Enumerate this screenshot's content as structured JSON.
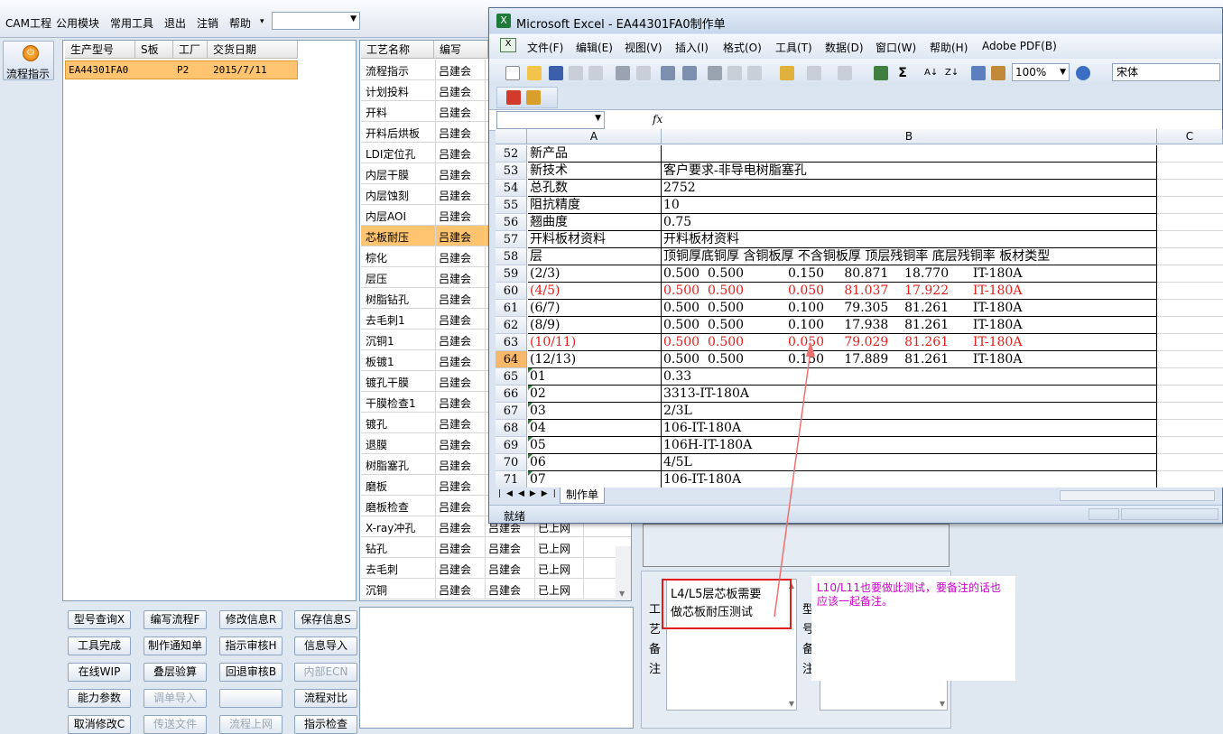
{
  "app": {
    "menu": [
      "CAM工程",
      "公用模块",
      "常用工具",
      "退出",
      "注销",
      "帮助"
    ],
    "help_arrow": "▾",
    "combo_value": ""
  },
  "left_strip": {
    "flow_button": "流程指示"
  },
  "product_grid": {
    "headers": [
      "生产型号",
      "S板",
      "工厂",
      "交货日期"
    ],
    "row": {
      "model": "EA44301FA0",
      "s": "",
      "factory": "P2",
      "date": "2015/7/11"
    }
  },
  "process_list": {
    "headers": [
      "工艺名称",
      "编写"
    ],
    "rows": [
      [
        "流程指示",
        "吕建会",
        "",
        ""
      ],
      [
        "计划投料",
        "吕建会",
        "",
        ""
      ],
      [
        "开料",
        "吕建会",
        "",
        ""
      ],
      [
        "开料后烘板",
        "吕建会",
        "",
        ""
      ],
      [
        "LDI定位孔",
        "吕建会",
        "",
        ""
      ],
      [
        "内层干膜",
        "吕建会",
        "",
        ""
      ],
      [
        "内层蚀刻",
        "吕建会",
        "",
        ""
      ],
      [
        "内层AOI",
        "吕建会",
        "",
        ""
      ],
      [
        "芯板耐压",
        "吕建会",
        "",
        ""
      ],
      [
        "棕化",
        "吕建会",
        "",
        ""
      ],
      [
        "层压",
        "吕建会",
        "",
        ""
      ],
      [
        "树脂钻孔",
        "吕建会",
        "",
        ""
      ],
      [
        "去毛刺1",
        "吕建会",
        "",
        ""
      ],
      [
        "沉铜1",
        "吕建会",
        "",
        ""
      ],
      [
        "板镀1",
        "吕建会",
        "",
        ""
      ],
      [
        "镀孔干膜",
        "吕建会",
        "",
        ""
      ],
      [
        "干膜检查1",
        "吕建会",
        "",
        ""
      ],
      [
        "镀孔",
        "吕建会",
        "",
        ""
      ],
      [
        "退膜",
        "吕建会",
        "",
        ""
      ],
      [
        "树脂塞孔",
        "吕建会",
        "",
        ""
      ],
      [
        "磨板",
        "吕建会",
        "",
        ""
      ],
      [
        "磨板检查",
        "吕建会",
        "",
        ""
      ],
      [
        "X-ray冲孔",
        "吕建会",
        "吕建会",
        "已上网"
      ],
      [
        "钻孔",
        "吕建会",
        "吕建会",
        "已上网"
      ],
      [
        "去毛刺",
        "吕建会",
        "吕建会",
        "已上网"
      ],
      [
        "沉铜",
        "吕建会",
        "吕建会",
        "已上网"
      ]
    ],
    "selected_index": 8
  },
  "buttons": [
    [
      "型号查询X",
      "编写流程F",
      "修改信息R",
      "保存信息S"
    ],
    [
      "工具完成",
      "制作通知单",
      "指示审核H",
      "信息导入"
    ],
    [
      "在线WIP",
      "叠层验算",
      "回退审核B",
      "内部ECN"
    ],
    [
      "能力参数",
      "调单导入",
      "",
      "流程对比"
    ],
    [
      "取消修改C",
      "传送文件",
      "流程上网",
      "指示检查"
    ]
  ],
  "disabled_buttons": [
    "内部ECN",
    "调单导入",
    "传送文件",
    "流程上网"
  ],
  "excel": {
    "title": "Microsoft Excel - EA44301FA0制作单",
    "menu": [
      "文件(F)",
      "编辑(E)",
      "视图(V)",
      "插入(I)",
      "格式(O)",
      "工具(T)",
      "数据(D)",
      "窗口(W)",
      "帮助(H)",
      "Adobe PDF(B)"
    ],
    "zoom": "100%",
    "font": "宋体",
    "fx": "fx",
    "columns": [
      "A",
      "B",
      "C"
    ],
    "rows": [
      {
        "n": "52",
        "a": "新产品",
        "b": ""
      },
      {
        "n": "53",
        "a": "新技术",
        "b": "客户要求-非导电树脂塞孔"
      },
      {
        "n": "54",
        "a": "总孔数",
        "b": "2752"
      },
      {
        "n": "55",
        "a": "阻抗精度",
        "b": "10"
      },
      {
        "n": "56",
        "a": "翘曲度",
        "b": "0.75"
      },
      {
        "n": "57",
        "a": "开料板材资料",
        "b": "开料板材资料"
      },
      {
        "n": "58",
        "a": "层",
        "b": "顶铜厚底铜厚 含铜板厚 不含铜板厚 顶层残铜率 底层残铜率 板材类型"
      },
      {
        "n": "59",
        "a": "(2/3)",
        "b": "0.500  0.500           0.150     80.871    18.770      IT-180A"
      },
      {
        "n": "60",
        "a": "(4/5)",
        "b": "0.500  0.500           0.050     81.037    17.922      IT-180A",
        "red": true
      },
      {
        "n": "61",
        "a": "(6/7)",
        "b": "0.500  0.500           0.100     79.305    81.261      IT-180A"
      },
      {
        "n": "62",
        "a": "(8/9)",
        "b": "0.500  0.500           0.100     17.938    81.261      IT-180A"
      },
      {
        "n": "63",
        "a": "(10/11)",
        "b": "0.500  0.500           0.050     79.029    81.261      IT-180A",
        "red": true
      },
      {
        "n": "64",
        "a": "(12/13)",
        "b": "0.500  0.500           0.150     17.889    81.261      IT-180A",
        "active": true
      },
      {
        "n": "65",
        "a": "01",
        "b": "0.33",
        "tri": true
      },
      {
        "n": "66",
        "a": "02",
        "b": "3313-IT-180A",
        "tri": true
      },
      {
        "n": "67",
        "a": "03",
        "b": "2/3L",
        "tri": true
      },
      {
        "n": "68",
        "a": "04",
        "b": "106-IT-180A",
        "tri": true
      },
      {
        "n": "69",
        "a": "05",
        "b": "106H-IT-180A",
        "tri": true
      },
      {
        "n": "70",
        "a": "06",
        "b": "4/5L",
        "tri": true
      },
      {
        "n": "71",
        "a": "07",
        "b": "106-IT-180A",
        "tri": true
      }
    ],
    "sheet_tab": "制作单",
    "status": "就绪"
  },
  "right_panel": {
    "note_red": "L4/L5层芯板需要",
    "note_text": "做芯板耐压测试",
    "side_labels_1": [
      "工",
      "艺",
      "备",
      "注"
    ],
    "side_labels_2": [
      "型",
      "号",
      "备",
      "注"
    ]
  },
  "annotation": {
    "text": "L10/L11也要做此测试，要备注的话也应该一起备注。",
    "color": "#cc00cc"
  },
  "colors": {
    "accent_selected": "#ffc46f",
    "red_text": "#e0201a",
    "arrow": "#f07070"
  }
}
